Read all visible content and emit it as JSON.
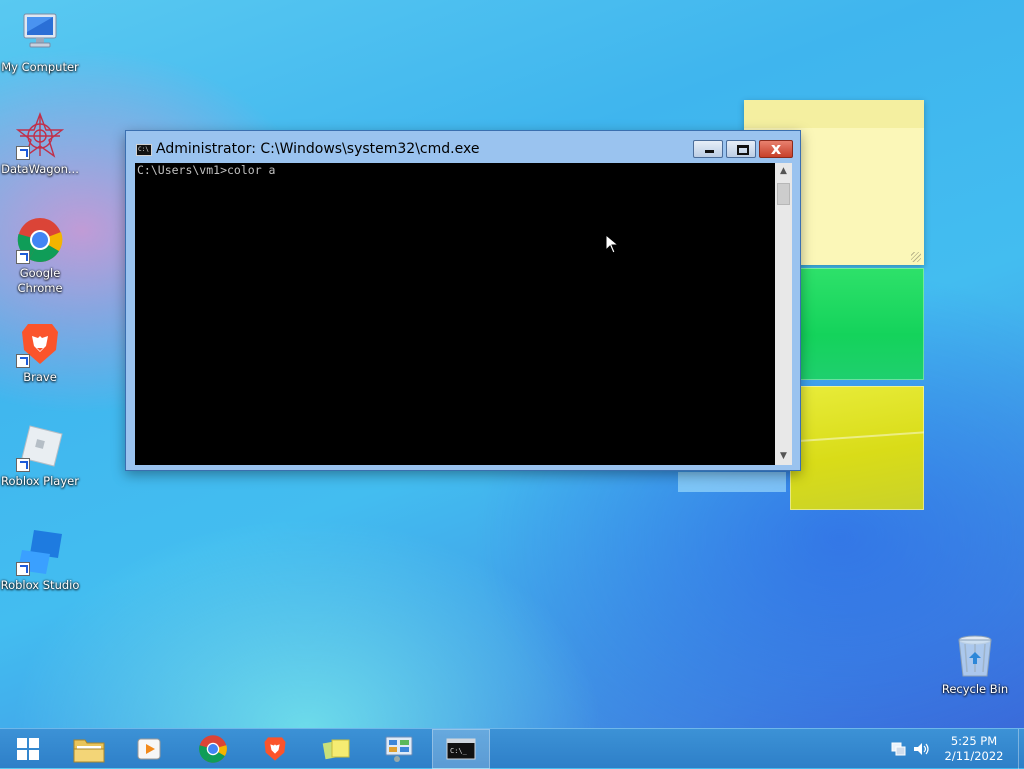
{
  "desktop": {
    "icons": [
      {
        "label": "My Computer"
      },
      {
        "label": "DataWagon..."
      },
      {
        "label": "Google Chrome"
      },
      {
        "label": "Brave"
      },
      {
        "label": "Roblox Player"
      },
      {
        "label": "Roblox Studio"
      },
      {
        "label": "Recycle Bin"
      }
    ]
  },
  "cmd_window": {
    "title": "Administrator: C:\\Windows\\system32\\cmd.exe",
    "console_text": "C:\\Users\\vm1>color a",
    "close_glyph": "x"
  },
  "taskbar": {
    "buttons": [
      "start",
      "file-explorer",
      "media-player",
      "google-chrome",
      "brave",
      "sticky-notes",
      "control-panel",
      "command-prompt"
    ],
    "active": "command-prompt",
    "clock": {
      "time": "5:25 PM",
      "date": "2/11/2022"
    }
  },
  "colors": {
    "taskbar": "#2e7fc8",
    "window_frame": "#9ac3ef",
    "close_button": "#c7402a",
    "console_bg": "#000000"
  }
}
